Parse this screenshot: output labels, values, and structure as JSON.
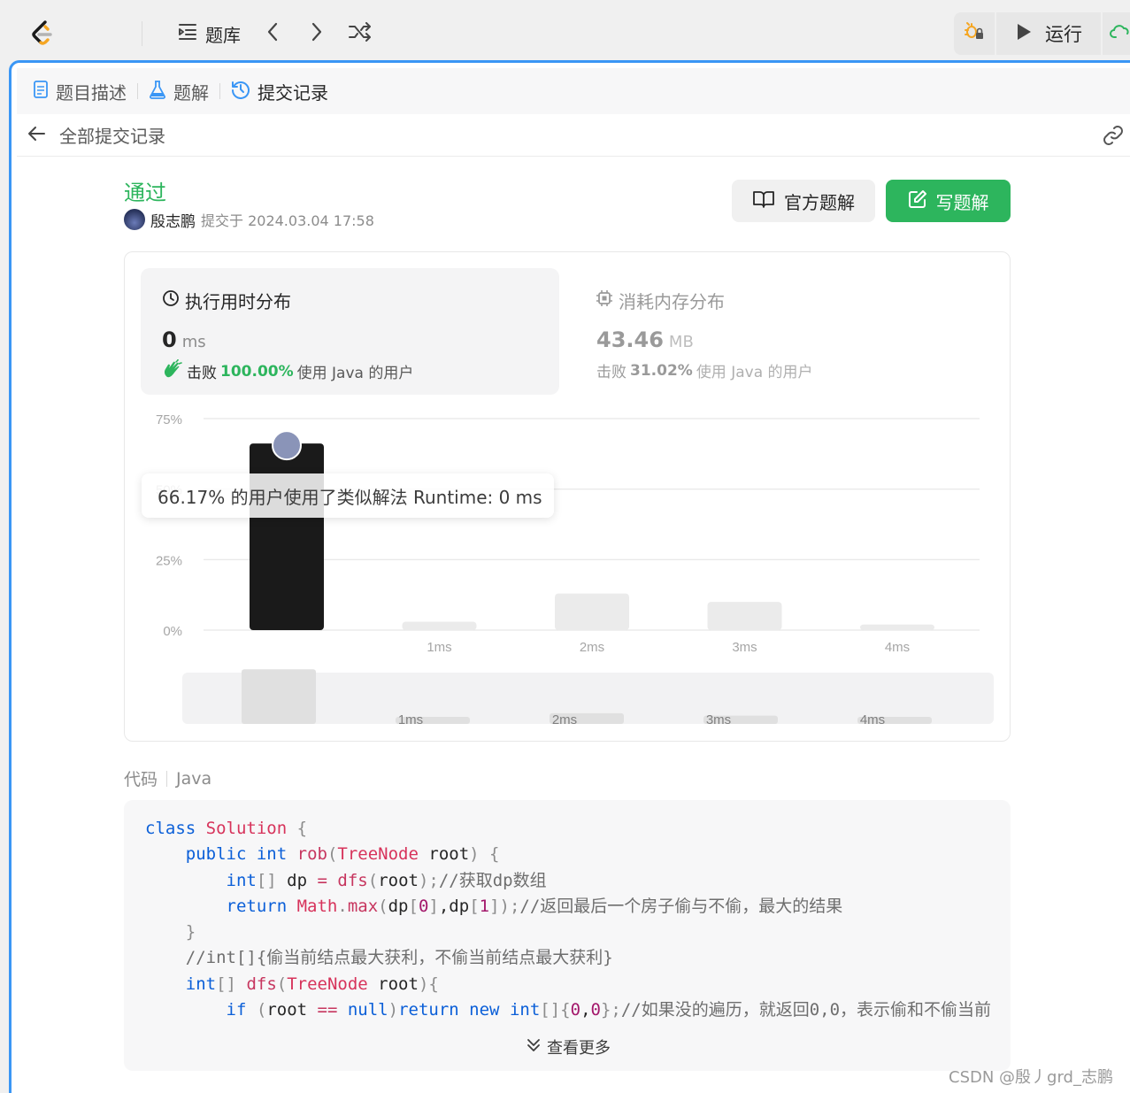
{
  "topbar": {
    "problem_bank_label": "题库",
    "run_label": "运行",
    "accent_color": "#3a96f5"
  },
  "tabs": [
    {
      "label": "题目描述",
      "icon": "document-icon"
    },
    {
      "label": "题解",
      "icon": "flask-icon"
    },
    {
      "label": "提交记录",
      "icon": "history-icon"
    }
  ],
  "breadcrumb": {
    "label": "全部提交记录"
  },
  "submission": {
    "status": "通过",
    "status_color": "#2db55d",
    "author": "殷志鹏",
    "submitted_text": "提交于 2024.03.04 17:58",
    "official_solution_label": "官方题解",
    "write_solution_label": "写题解"
  },
  "stats": {
    "runtime": {
      "title": "执行用时分布",
      "value": "0",
      "unit": "ms",
      "beat_prefix": "击败",
      "beat_pct": "100.00%",
      "beat_suffix": "使用 Java 的用户"
    },
    "memory": {
      "title": "消耗内存分布",
      "value": "43.46",
      "unit": "MB",
      "beat_prefix": "击败",
      "beat_pct": "31.02%",
      "beat_suffix": "使用 Java 的用户"
    }
  },
  "tooltip": {
    "text": "66.17% 的用户使用了类似解法 Runtime: 0 ms"
  },
  "chart_data": {
    "type": "bar",
    "categories": [
      "0ms",
      "1ms",
      "2ms",
      "3ms",
      "4ms"
    ],
    "category_labels": [
      "",
      "1ms",
      "2ms",
      "3ms",
      "4ms"
    ],
    "values": [
      66.17,
      3,
      13,
      10,
      2
    ],
    "highlight_index": 0,
    "ylim": [
      0,
      75
    ],
    "yticks": [
      0,
      25,
      50,
      75
    ],
    "ytick_labels": [
      "0%",
      "25%",
      "50%",
      "75%"
    ],
    "highlight_color": "#1a1a1a",
    "bar_color": "#ebebeb",
    "grid": true,
    "xlabel": "",
    "ylabel": ""
  },
  "code": {
    "label": "代码",
    "language": "Java",
    "show_more_label": "查看更多"
  },
  "watermark": "CSDN @殷丿grd_志鹏"
}
